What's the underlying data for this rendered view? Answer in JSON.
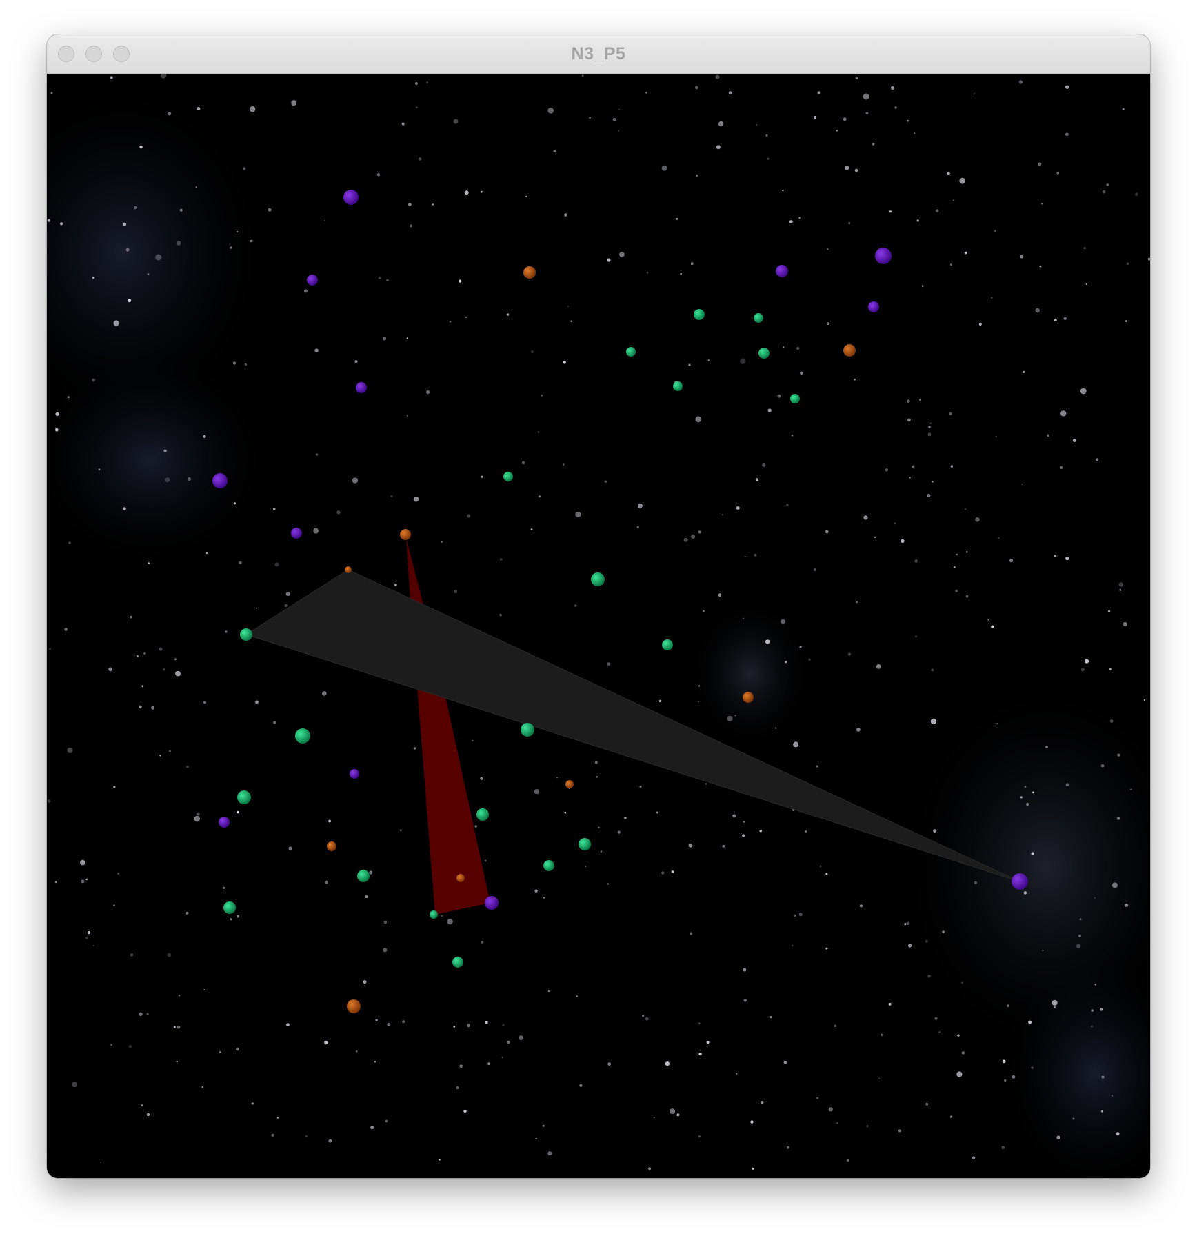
{
  "window": {
    "title": "N3_P5"
  },
  "colors": {
    "titlebar_text": "#a3a3a3",
    "background": "#000000",
    "green": "#0fa65f",
    "purple": "#5a0fb4",
    "orange": "#b4530f",
    "gray_triangle": "#1c1c1c",
    "red_triangle": "#5e0000"
  },
  "icons": [
    "close-button",
    "minimize-button",
    "maximize-button"
  ]
}
